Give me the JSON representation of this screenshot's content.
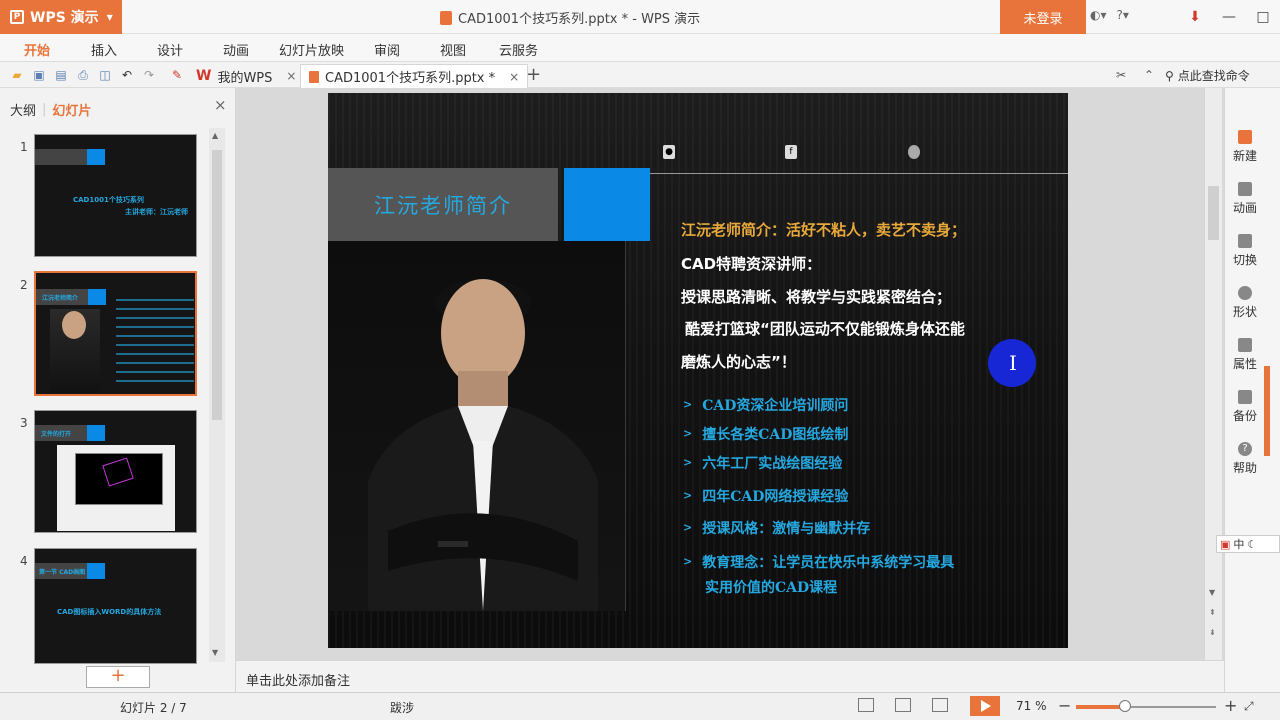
{
  "app": {
    "name": "WPS 演示",
    "document_title": "CAD1001个技巧系列.pptx * - WPS 演示",
    "login_label": "未登录"
  },
  "menu": [
    "开始",
    "插入",
    "设计",
    "动画",
    "幻灯片放映",
    "审阅",
    "视图",
    "云服务"
  ],
  "active_menu": "开始",
  "tabs": [
    {
      "label": "我的WPS",
      "close": "×"
    },
    {
      "label": "CAD1001个技巧系列.pptx *",
      "close": "×"
    }
  ],
  "add_tab": "+",
  "search_cmd": "点此查找命令",
  "panel": {
    "tab_outline": "大纲",
    "tab_slides": "幻灯片",
    "close": "×",
    "add": "+"
  },
  "thumbnails": [
    {
      "num": "1",
      "line1": "CAD1001个技巧系列",
      "line2": "主讲老师：江沅老师"
    },
    {
      "num": "2",
      "line1": "江沅老师简介"
    },
    {
      "num": "3",
      "line1": "文件的打开"
    },
    {
      "num": "4",
      "line1": "第一节 CAD画图",
      "line2": "CAD图标插入WORD的具体方法"
    }
  ],
  "slide": {
    "title": "江沅老师简介",
    "intro": [
      "江沅老师简介：活好不粘人，卖艺不卖身；",
      "CAD特聘资深讲师：",
      "授课思路清晰、将教学与实践紧密结合；",
      "酷爱打篮球“团队运动不仅能锻炼身体还能",
      "磨炼人的心志”！"
    ],
    "bullet_mark": ">",
    "bullets": [
      "CAD资深企业培训顾问",
      "擅长各类CAD图纸绘制",
      "六年工厂实战绘图经验",
      "四年CAD网络授课经验",
      "授课风格：激情与幽默并存",
      "教育理念：让学员在快乐中系统学习最具",
      "实用价值的CAD课程"
    ],
    "cursor_glyph": "I"
  },
  "notes_placeholder": "单击此处添加备注",
  "side_panel": [
    "新建",
    "动画",
    "切换",
    "形状",
    "属性",
    "备份",
    "帮助"
  ],
  "ime": "中",
  "status": {
    "slide_counter": "幻灯片 2 / 7",
    "theme": "跋涉",
    "zoom": "71 %",
    "zoom_fraction": 0.35
  },
  "colors": {
    "accent": "#e8743b",
    "slide_blue": "#0a8ae6",
    "title_text": "#25a8e0",
    "highlight": "#e8a93a"
  }
}
